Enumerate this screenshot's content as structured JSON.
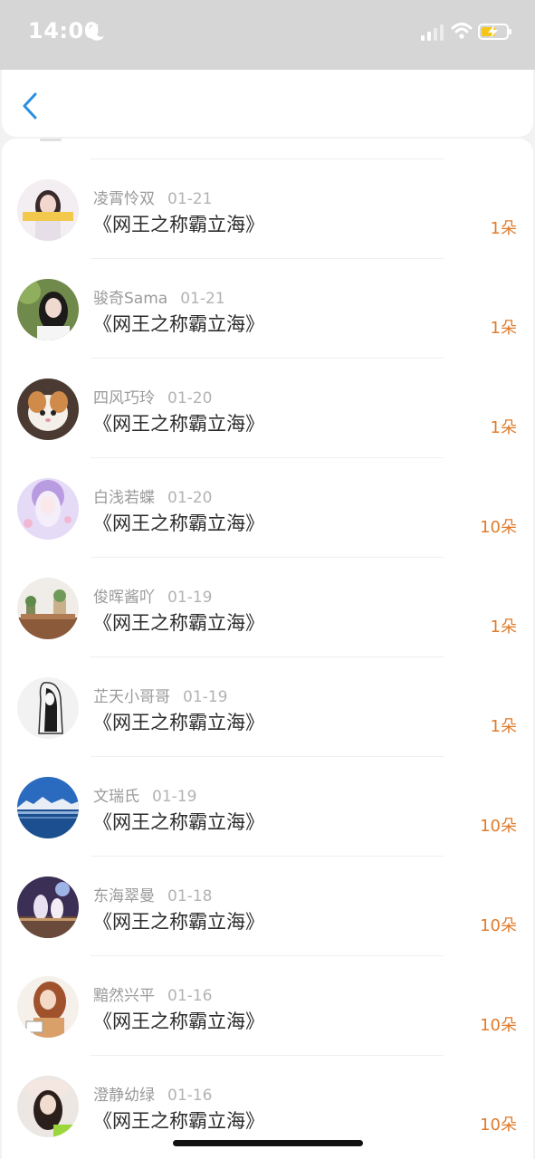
{
  "status_bar": {
    "time": "14:00",
    "icons": [
      "moon-icon",
      "signal-icon",
      "wifi-icon",
      "battery-charging-icon"
    ],
    "battery_color": "#f5c518"
  },
  "nav": {
    "back_icon": "chevron-left-icon",
    "accent": "#2a8fe0"
  },
  "list": {
    "count_color": "#e07b2a",
    "items": [
      {
        "user": "凌霄怜双",
        "date": "01-21",
        "title": "《网王之称霸立海》",
        "count": "1朵",
        "avatar": "girl-portrait"
      },
      {
        "user": "骏奇Sama",
        "date": "01-21",
        "title": "《网王之称霸立海》",
        "count": "1朵",
        "avatar": "girl-leaves"
      },
      {
        "user": "四风巧玲",
        "date": "01-20",
        "title": "《网王之称霸立海》",
        "count": "1朵",
        "avatar": "cat"
      },
      {
        "user": "白浅若蝶",
        "date": "01-20",
        "title": "《网王之称霸立海》",
        "count": "10朵",
        "avatar": "anime-purple"
      },
      {
        "user": "俊晖酱吖",
        "date": "01-19",
        "title": "《网王之称霸立海》",
        "count": "1朵",
        "avatar": "plants-shelf"
      },
      {
        "user": "芷天小哥哥",
        "date": "01-19",
        "title": "《网王之称霸立海》",
        "count": "1朵",
        "avatar": "sketch-figure"
      },
      {
        "user": "文瑞氏",
        "date": "01-19",
        "title": "《网王之称霸立海》",
        "count": "10朵",
        "avatar": "lake-mountains"
      },
      {
        "user": "东海翠曼",
        "date": "01-18",
        "title": "《网王之称霸立海》",
        "count": "10朵",
        "avatar": "anime-night"
      },
      {
        "user": "黯然兴平",
        "date": "01-16",
        "title": "《网王之称霸立海》",
        "count": "10朵",
        "avatar": "girl-curly-hair"
      },
      {
        "user": "澄静幼绿",
        "date": "01-16",
        "title": "《网王之称霸立海》",
        "count": "10朵",
        "avatar": "girl-cap"
      }
    ]
  }
}
